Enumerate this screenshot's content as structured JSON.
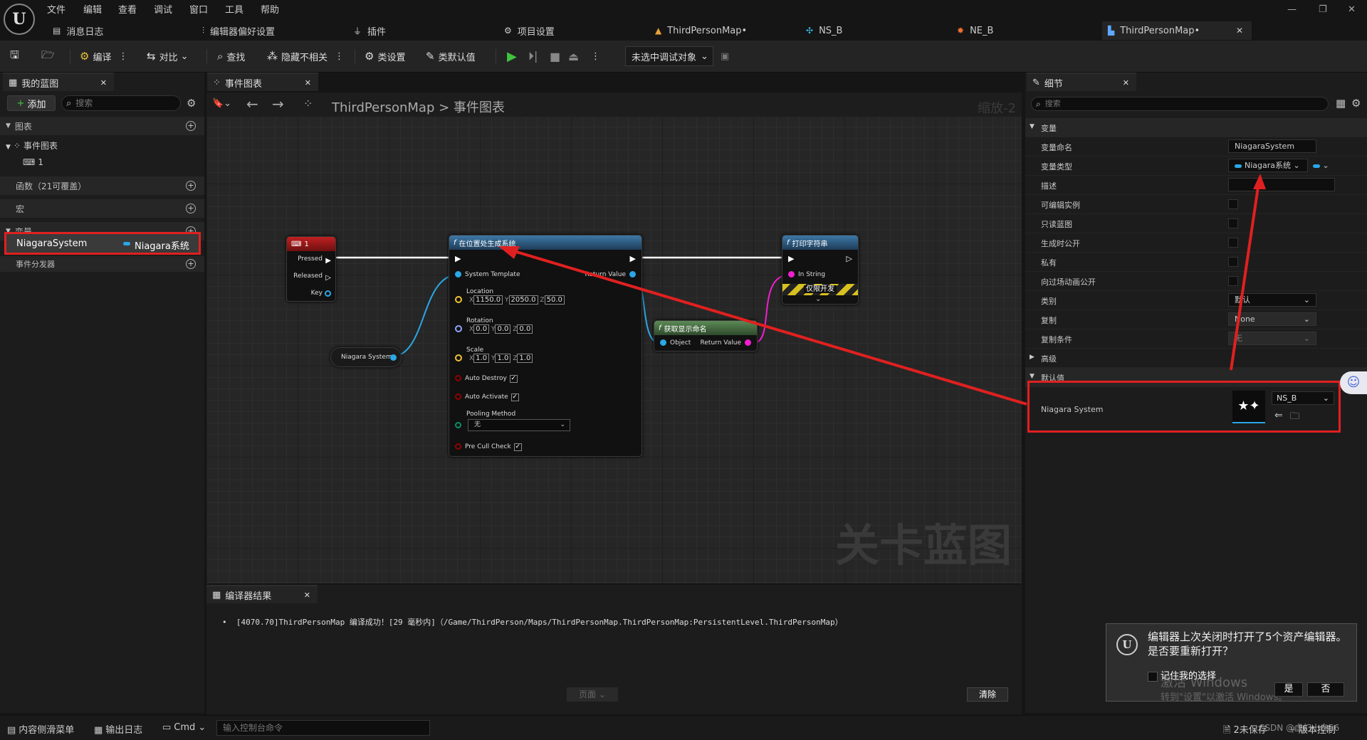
{
  "menu": [
    "文件",
    "编辑",
    "查看",
    "调试",
    "窗口",
    "工具",
    "帮助"
  ],
  "tabs": [
    {
      "label": "消息日志",
      "icon": "log-icon"
    },
    {
      "label": "编辑器偏好设置",
      "icon": "sliders-icon"
    },
    {
      "label": "插件",
      "icon": "plug-icon"
    },
    {
      "label": "项目设置",
      "icon": "gear-icon"
    },
    {
      "label": "ThirdPersonMap•",
      "icon": "map-icon"
    },
    {
      "label": "NS_B",
      "icon": "niagara-icon"
    },
    {
      "label": "NE_B",
      "icon": "emitter-icon"
    },
    {
      "label": "ThirdPersonMap•",
      "icon": "blueprint-icon"
    }
  ],
  "toolbar": {
    "compile": "编译",
    "diff": "对比",
    "find": "查找",
    "hide_unrelated": "隐藏不相关",
    "class_settings": "类设置",
    "class_defaults": "类默认值",
    "debug_object": "未选中调试对象"
  },
  "left": {
    "tab": "我的蓝图",
    "add": "添加",
    "search_placeholder": "搜索",
    "graphs": "图表",
    "event_graph": "事件图表",
    "event_graph_child": "1",
    "functions": "函数（21可覆盖）",
    "macros": "宏",
    "variables": "变量",
    "var_name": "NiagaraSystem",
    "var_type": "Niagara系统",
    "dispatchers": "事件分发器"
  },
  "graph_tab": {
    "label": "事件图表",
    "crumb_root": "ThirdPersonMap",
    "crumb_leaf": "事件图表",
    "zoom": "缩放-2",
    "watermark": "关卡蓝图"
  },
  "nodes": {
    "key1": {
      "title": "1",
      "pressed": "Pressed",
      "released": "Released",
      "key": "Key"
    },
    "spawn": {
      "title": "在位置处生成系统",
      "template": "System Template",
      "return": "Return Value",
      "location": "Location",
      "loc": [
        "1150.0",
        "2050.0",
        "50.0"
      ],
      "rotation": "Rotation",
      "rot": [
        "0.0",
        "0.0",
        "0.0"
      ],
      "scale": "Scale",
      "scl": [
        "1.0",
        "1.0",
        "1.0"
      ],
      "auto_destroy": "Auto Destroy",
      "auto_activate": "Auto Activate",
      "pooling": "Pooling Method",
      "pooling_value": "无",
      "pre_cull": "Pre Cull Check",
      "x": "X",
      "y": "Y",
      "z": "Z"
    },
    "niagara_var": {
      "label": "Niagara System"
    },
    "print": {
      "title": "打印字符串",
      "in_string": "In String",
      "dev_only": "仅限开发"
    },
    "display_name": {
      "title": "获取显示命名",
      "object": "Object",
      "return": "Return Value"
    }
  },
  "details": {
    "tab": "细节",
    "search_placeholder": "搜索",
    "section_variable": "变量",
    "rows": [
      {
        "label": "变量命名",
        "value": "NiagaraSystem"
      },
      {
        "label": "变量类型",
        "value": "Niagara系统"
      },
      {
        "label": "描述",
        "value": ""
      },
      {
        "label": "可编辑实例"
      },
      {
        "label": "只读蓝图"
      },
      {
        "label": "生成时公开"
      },
      {
        "label": "私有"
      },
      {
        "label": "向过场动画公开"
      },
      {
        "label": "类别",
        "value": "默认"
      },
      {
        "label": "复制",
        "value": "None"
      },
      {
        "label": "复制条件",
        "value": "无"
      }
    ],
    "advanced": "高级",
    "section_default": "默认值",
    "default_label": "Niagara System",
    "asset": "NS_B"
  },
  "compiler": {
    "tab": "编译器结果",
    "message": "[4070.70]ThirdPersonMap 编译成功！[29 毫秒内]（/Game/ThirdPerson/Maps/ThirdPersonMap.ThirdPersonMap:PersistentLevel.ThirdPersonMap）",
    "page": "页面",
    "clear": "清除"
  },
  "status": {
    "content_drawer": "内容侧滑菜单",
    "output_log": "输出日志",
    "cmd": "Cmd",
    "console_placeholder": "输入控制台命令",
    "unsaved": "2未保存",
    "source_control": "版本控制"
  },
  "popup": {
    "text": "编辑器上次关闭时打开了5个资产编辑器。是否要重新打开？",
    "remember": "记住我的选择",
    "yes": "是",
    "no": "否",
    "activate1": "激活 Windows",
    "activate2": "转到\"设置\"以激活 Windows。",
    "csdn": "CSDN @虚幻小白56"
  },
  "colors": {
    "highlight": "#e02020",
    "exec": "#ffffff",
    "object_pin": "#2aa7e6",
    "string_pin": "#f01fcf",
    "vector_pin": "#f1c232",
    "rotator_pin": "#8fa4ff",
    "bool_pin": "#920101",
    "play": "#3ec43e"
  }
}
